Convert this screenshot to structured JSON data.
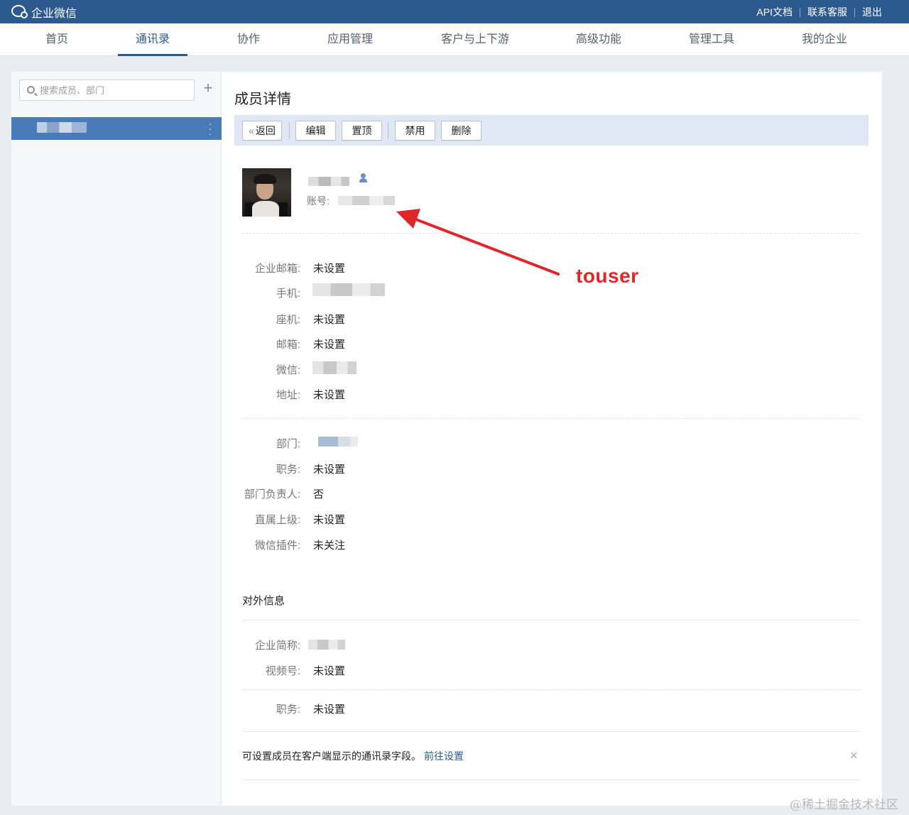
{
  "header": {
    "logo_text": "企业微信",
    "links": [
      "API文档",
      "联系客服",
      "退出"
    ]
  },
  "nav": {
    "items": [
      "首页",
      "通讯录",
      "协作",
      "应用管理",
      "客户与上下游",
      "高级功能",
      "管理工具",
      "我的企业"
    ],
    "active": "通讯录"
  },
  "sidebar": {
    "search_placeholder": "搜索成员、部门",
    "add_icon": "plus-icon"
  },
  "detail": {
    "title": "成员详情",
    "buttons": {
      "back": "返回",
      "edit": "编辑",
      "pin": "置顶",
      "disable": "禁用",
      "delete": "删除"
    },
    "account_label": "账号:",
    "contact": [
      {
        "label": "企业邮箱:",
        "value": "未设置"
      },
      {
        "label": "手机:",
        "value": ""
      },
      {
        "label": "座机:",
        "value": "未设置"
      },
      {
        "label": "邮箱:",
        "value": "未设置"
      },
      {
        "label": "微信:",
        "value": ""
      },
      {
        "label": "地址:",
        "value": "未设置"
      }
    ],
    "org": [
      {
        "label": "部门:",
        "value": ""
      },
      {
        "label": "职务:",
        "value": "未设置"
      },
      {
        "label": "部门负责人:",
        "value": "否"
      },
      {
        "label": "直属上级:",
        "value": "未设置"
      },
      {
        "label": "微信插件:",
        "value": "未关注"
      }
    ],
    "external_title": "对外信息",
    "external": [
      {
        "label": "企业简称:",
        "value": ""
      },
      {
        "label": "视频号:",
        "value": "未设置"
      },
      {
        "label": "职务:",
        "value": "未设置"
      }
    ],
    "notice_text": "可设置成员在客户端显示的通讯录字段。",
    "notice_link": "前往设置",
    "close_symbol": "×"
  },
  "annotation": {
    "text": "touser",
    "color": "#e0262a"
  },
  "watermark": "@稀土掘金技术社区"
}
